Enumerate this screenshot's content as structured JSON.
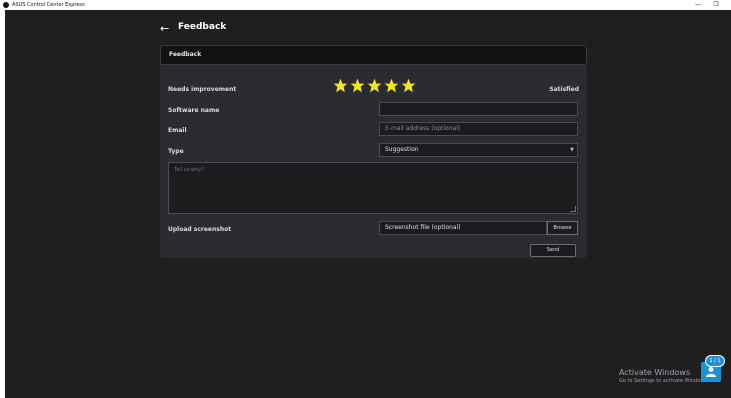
{
  "window": {
    "title": "ASUS Control Center Express",
    "min_icon": "minimize-icon",
    "max_icon": "maximize-icon"
  },
  "header": {
    "back_icon": "arrow-left-icon",
    "title": "Feedback"
  },
  "panel": {
    "heading": "Feedback",
    "rating": {
      "low_label": "Needs improvement",
      "high_label": "Satisfied",
      "stars": 5,
      "max": 5,
      "star_color": "#f5e61c"
    },
    "software_name": {
      "label": "Software name",
      "value": "",
      "placeholder": ""
    },
    "email": {
      "label": "Email",
      "placeholder": "E-mail address (optional)"
    },
    "type": {
      "label": "Type",
      "value": "Suggestion"
    },
    "comment": {
      "placeholder": "Tell us why?"
    },
    "upload": {
      "label": "Upload screenshot",
      "file_placeholder": "Screenshot file (optional)",
      "browse_label": "Browse"
    },
    "send_label": "Send"
  },
  "watermark": {
    "title": "Activate Windows",
    "subtitle": "Go to Settings to activate Windows."
  },
  "chat": {
    "badge": "1 / 1",
    "icon": "chat-icon"
  }
}
